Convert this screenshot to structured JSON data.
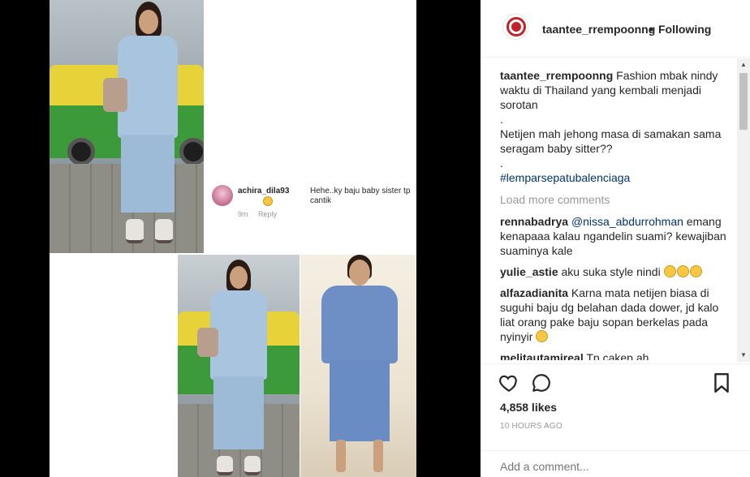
{
  "header": {
    "username": "taantee_rrempoonng",
    "separator": "•",
    "follow_status": "Following"
  },
  "caption": {
    "username": "taantee_rrempoonng",
    "text_1": "Fashion mbak nindy waktu di Thailand yang kembali menjadi sorotan",
    "dot_1": ".",
    "text_2": "Netijen mah jehong masa di samakan sama seragam baby sitter??",
    "dot_2": ".",
    "hashtag": "#lemparsepatubalenciaga"
  },
  "load_more": "Load more comments",
  "comments": [
    {
      "username": "rennabadrya",
      "mention": "@nissa_abdurrohman",
      "text": " emang kenapaaa kalau ngandelin suami? kewajiban suaminya kale"
    },
    {
      "username": "yulie_astie",
      "text": " aku suka style nindi"
    },
    {
      "username": "alfazadianita",
      "text": " Karna mata netijen biasa di suguhi baju dg belahan dada dower, jd kalo liat orang pake baju sopan berkelas pada nyinyir"
    },
    {
      "username": "melitautamireal",
      "text": " Tp cakep ah.."
    }
  ],
  "inner_comment": {
    "username": "achira_dila93",
    "text": "Hehe..ky baju baby sister tp cantik",
    "time": "9m",
    "reply": "Reply"
  },
  "likes": "4,858 likes",
  "timestamp": "10 HOURS AGO",
  "add_comment_placeholder": "Add a comment...",
  "icons": {
    "like": "heart-icon",
    "comment": "speech-bubble-icon",
    "save": "bookmark-icon",
    "scroll_up": "▲",
    "scroll_down": "▼"
  },
  "colors": {
    "link": "#003569",
    "muted": "#999999",
    "brand_red": "#c2232a"
  }
}
